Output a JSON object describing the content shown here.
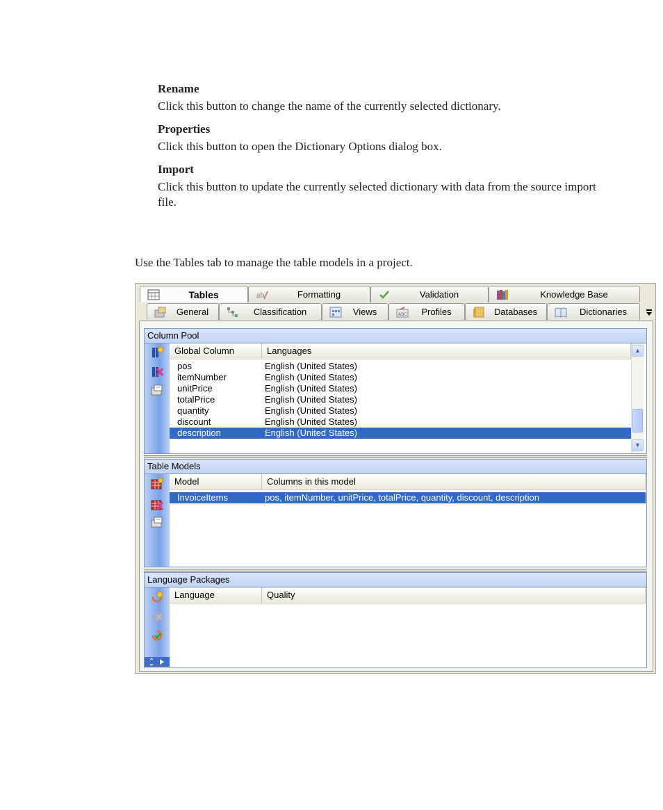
{
  "doc": {
    "items": [
      {
        "term": "Rename",
        "desc": "Click this button to change the name of the currently selected dictionary."
      },
      {
        "term": "Properties",
        "desc": "Click this button to open the Dictionary Options dialog box."
      },
      {
        "term": "Import",
        "desc": "Click this button to update the currently selected dictionary with data from the source import file."
      }
    ],
    "intro": "Use the Tables tab to manage the table models in a project."
  },
  "window": {
    "tabs_row1": [
      {
        "label": "Tables",
        "icon": "table-icon",
        "active": true
      },
      {
        "label": "Formatting",
        "icon": "ab-formatting-icon",
        "active": false
      },
      {
        "label": "Validation",
        "icon": "checkmark-icon",
        "active": false
      },
      {
        "label": "Knowledge Base",
        "icon": "books-icon",
        "active": false
      }
    ],
    "tabs_row2": [
      {
        "label": "General",
        "icon": "general-icon"
      },
      {
        "label": "Classification",
        "icon": "tree-icon"
      },
      {
        "label": "Views",
        "icon": "views-icon"
      },
      {
        "label": "Profiles",
        "icon": "profile-icon"
      },
      {
        "label": "Databases",
        "icon": "database-icon"
      },
      {
        "label": "Dictionaries",
        "icon": "dictionary-icon"
      }
    ],
    "overflow_icon": "overflow-arrow-icon",
    "column_pool": {
      "title": "Column Pool",
      "headers": [
        "Global Column",
        "Languages"
      ],
      "rows": [
        {
          "name": "pos",
          "languages": "English (United States)",
          "selected": false
        },
        {
          "name": "itemNumber",
          "languages": "English (United States)",
          "selected": false
        },
        {
          "name": "unitPrice",
          "languages": "English (United States)",
          "selected": false
        },
        {
          "name": "totalPrice",
          "languages": "English (United States)",
          "selected": false
        },
        {
          "name": "quantity",
          "languages": "English (United States)",
          "selected": false
        },
        {
          "name": "discount",
          "languages": "English (United States)",
          "selected": false
        },
        {
          "name": "description",
          "languages": "English (United States)",
          "selected": true
        }
      ],
      "toolbar": [
        "add-column-icon",
        "delete-column-icon",
        "column-properties-icon"
      ]
    },
    "table_models": {
      "title": "Table Models",
      "headers": [
        "Model",
        "Columns in this model"
      ],
      "rows": [
        {
          "model": "InvoiceItems",
          "columns": "pos, itemNumber, unitPrice, totalPrice, quantity, discount, description",
          "selected": true
        }
      ],
      "toolbar": [
        "add-model-icon",
        "delete-model-icon",
        "model-properties-icon"
      ]
    },
    "language_packages": {
      "title": "Language Packages",
      "headers": [
        "Language",
        "Quality"
      ],
      "rows": [],
      "toolbar": [
        "add-language-icon",
        "remove-language-icon",
        "refresh-language-icon"
      ]
    }
  }
}
